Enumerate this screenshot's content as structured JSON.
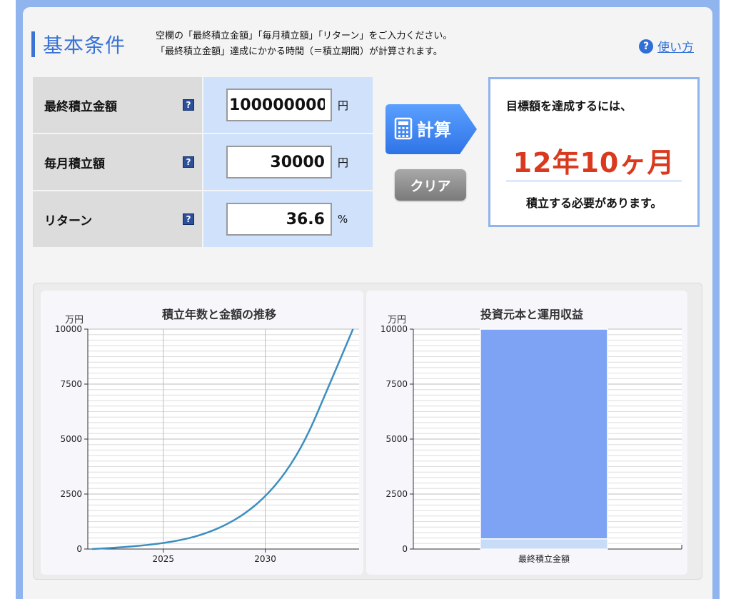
{
  "header": {
    "title": "基本条件",
    "description": "空欄の「最終積立金額」「毎月積立額」「リターン」をご入力ください。\n「最終積立金額」達成にかかる時間（＝積立期間）が計算されます。",
    "help_icon": "?",
    "help_label": "使い方"
  },
  "form": {
    "rows": [
      {
        "label": "最終積立金額",
        "value": "100000000",
        "unit": "円"
      },
      {
        "label": "毎月積立額",
        "value": "30000",
        "unit": "円"
      },
      {
        "label": "リターン",
        "value": "36.6",
        "unit": "%"
      }
    ],
    "help_glyph": "?"
  },
  "buttons": {
    "calc_label": "計算",
    "clear_label": "クリア"
  },
  "result": {
    "top_text": "目標額を達成するには、",
    "duration": "12年10ヶ月",
    "bottom_text": "積立する必要があります。"
  },
  "colors": {
    "accent": "#3a72d6",
    "result_red": "#d93a1e",
    "line": "#3c8fbf",
    "bar_main": "#7ea3f4",
    "bar_base": "#c8dcf8"
  },
  "chart_data": [
    {
      "type": "line",
      "title": "積立年数と金額の推移",
      "ylabel": "万円",
      "ylim": [
        0,
        10000
      ],
      "yticks": [
        "10000",
        "7500",
        "5000",
        "2500",
        "0"
      ],
      "xticks": [
        "2025",
        "2030"
      ],
      "series": [
        {
          "x": [
            2021.5,
            2022,
            2023,
            2024,
            2025,
            2026,
            2027,
            2028,
            2029,
            2030,
            2031,
            2032,
            2033,
            2034.3
          ],
          "values": [
            0,
            25,
            80,
            160,
            270,
            430,
            680,
            1060,
            1600,
            2370,
            3460,
            5000,
            7150,
            10000
          ]
        }
      ]
    },
    {
      "type": "bar",
      "title": "投資元本と運用収益",
      "ylabel": "万円",
      "ylim": [
        0,
        10000
      ],
      "yticks": [
        "10000",
        "7500",
        "5000",
        "2500",
        "0"
      ],
      "categories": [
        "最終積立金額"
      ],
      "series": [
        {
          "values": [
            462
          ]
        },
        {
          "values": [
            9538
          ]
        }
      ]
    }
  ]
}
